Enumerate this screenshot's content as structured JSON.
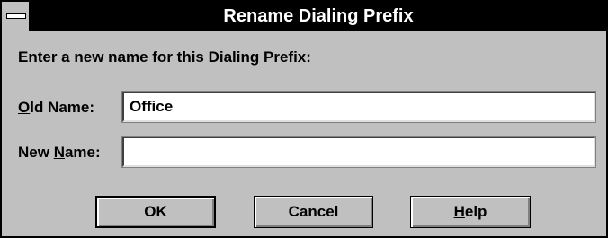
{
  "window": {
    "title": "Rename Dialing Prefix"
  },
  "prompt": "Enter a new name for this Dialing Prefix:",
  "old_name": {
    "label_mnemonic": "O",
    "label_rest": "ld Name:",
    "value": "Office"
  },
  "new_name": {
    "label_pre": "New ",
    "label_mnemonic": "N",
    "label_rest": "ame:",
    "value": ""
  },
  "buttons": {
    "ok": "OK",
    "cancel": "Cancel",
    "help_mnemonic": "H",
    "help_rest": "elp"
  }
}
